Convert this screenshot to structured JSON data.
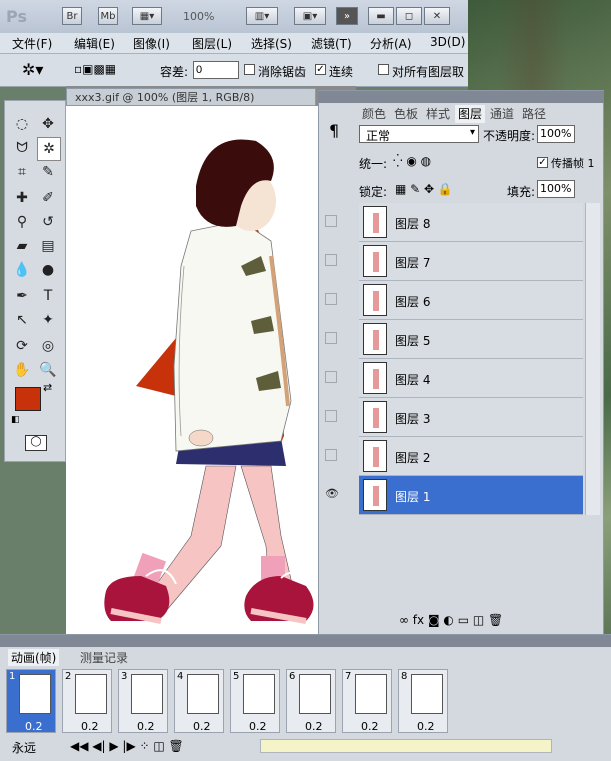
{
  "app": {
    "logo": "Ps",
    "bridge": "Br",
    "minibridge": "Mb",
    "zoom": "100%",
    "expand": "»"
  },
  "menu": [
    "文件(F)",
    "编辑(E)",
    "图像(I)",
    "图层(L)",
    "选择(S)",
    "滤镜(T)",
    "分析(A)",
    "3D(D)"
  ],
  "options": {
    "tolerance_label": "容差:",
    "tolerance_value": "0",
    "antialias": "消除锯齿",
    "contiguous": "连续",
    "all_layers": "对所有图层取"
  },
  "document": {
    "tab_title": "xxx3.gif @ 100% (图层 1, RGB/8)"
  },
  "layers_panel": {
    "tabs": [
      "颜色",
      "色板",
      "样式",
      "图层",
      "通道",
      "路径"
    ],
    "active_tab": "图层",
    "blend_mode": "正常",
    "opacity_label": "不透明度:",
    "opacity_value": "100%",
    "unify_label": "统一:",
    "propagate_label": "传播帧 1",
    "lock_label": "锁定:",
    "fill_label": "填充:",
    "fill_value": "100%",
    "layers": [
      "图层 8",
      "图层 7",
      "图层 6",
      "图层 5",
      "图层 4",
      "图层 3",
      "图层 2",
      "图层 1"
    ],
    "selected_layer": "图层 1"
  },
  "animation": {
    "tabs": [
      "动画(帧)",
      "测量记录"
    ],
    "frames": [
      {
        "n": "1",
        "d": "0.2"
      },
      {
        "n": "2",
        "d": "0.2"
      },
      {
        "n": "3",
        "d": "0.2"
      },
      {
        "n": "4",
        "d": "0.2"
      },
      {
        "n": "5",
        "d": "0.2"
      },
      {
        "n": "6",
        "d": "0.2"
      },
      {
        "n": "7",
        "d": "0.2"
      },
      {
        "n": "8",
        "d": "0.2"
      }
    ],
    "loop": "永远"
  },
  "colors": {
    "foreground": "#c8320a",
    "background": "#ffffff",
    "selection": "#3a6fd0"
  }
}
